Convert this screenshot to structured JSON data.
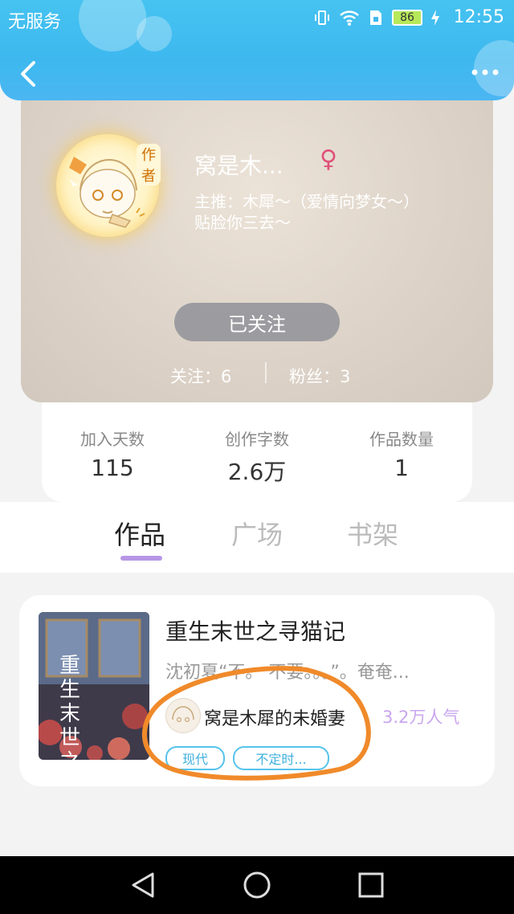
{
  "status_bar": {
    "carrier": "无服务",
    "battery": "86",
    "time": "12:55"
  },
  "profile": {
    "author_tag": "作者",
    "username": "窝是木...",
    "gender_symbol": "♀",
    "bio_line1": "主推：木犀～（爱情向梦女～）",
    "bio_line2": "贴脸你三去～",
    "follow_button": "已关注",
    "following_text": "关注：6",
    "fans_text": "粉丝：3"
  },
  "stats": [
    {
      "label": "加入天数",
      "value": "115"
    },
    {
      "label": "创作字数",
      "value": "2.6万"
    },
    {
      "label": "作品数量",
      "value": "1"
    }
  ],
  "tabs": [
    {
      "label": "作品",
      "active": true
    },
    {
      "label": "广场",
      "active": false
    },
    {
      "label": "书架",
      "active": false
    }
  ],
  "work": {
    "title": "重生末世之寻猫记",
    "description": "沈初夏“不。      不要。。。”。奄奄...",
    "author_name": "窝是木犀的未婚妻",
    "popularity": "3.2万人气",
    "tags": [
      "现代",
      "不定时..."
    ],
    "cover_text": "重生末世之寻猫记"
  },
  "colors": {
    "header": "#3db8ef",
    "accent": "#b796e6",
    "tag": "#56c3ec",
    "annotation": "#f08a2a"
  }
}
